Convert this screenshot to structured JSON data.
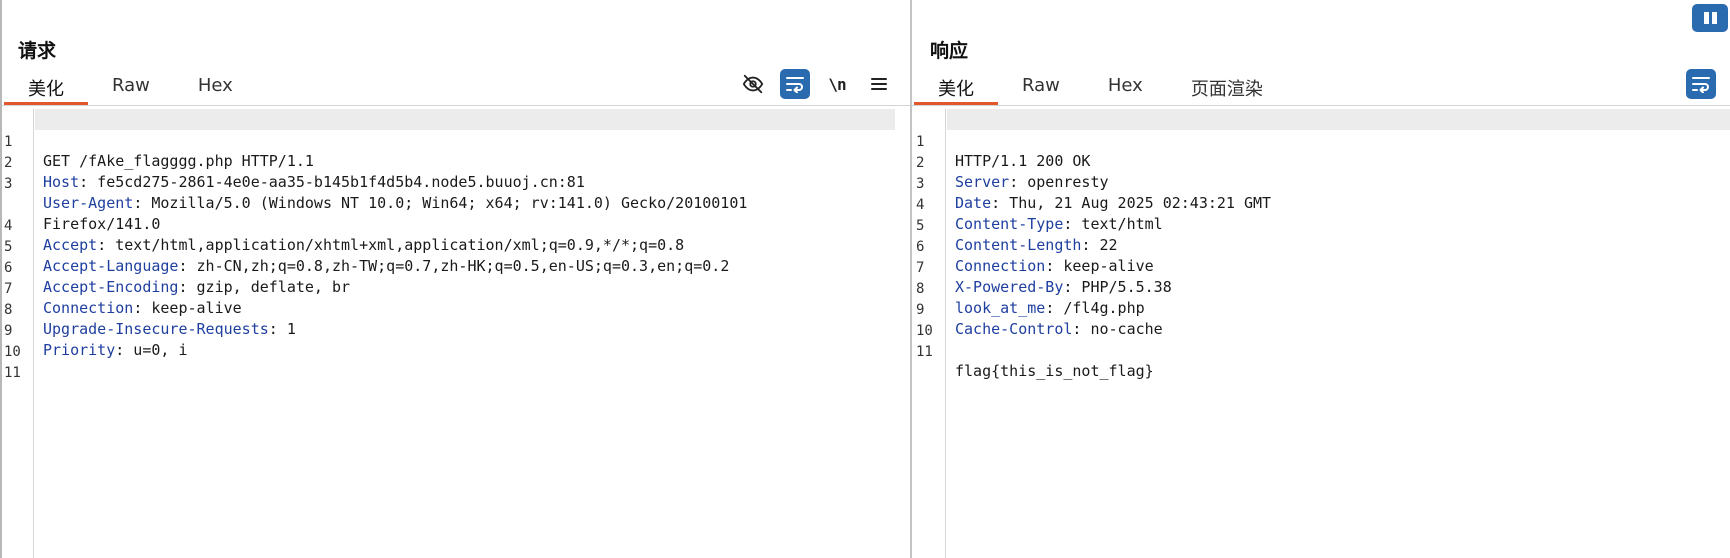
{
  "request": {
    "title": "请求",
    "tabs": [
      "美化",
      "Raw",
      "Hex"
    ],
    "toolbar": {
      "hide_icon": "eye-slash-icon",
      "wrap_icon": "wrap-lines-icon",
      "newline_label": "\\n",
      "menu_icon": "hamburger-menu-icon"
    },
    "lines": [
      {
        "n": "1",
        "first": "GET /fAke_flagggg.php HTTP/1.1",
        "key": "",
        "val": ""
      },
      {
        "n": "2",
        "first": "",
        "key": "Host",
        "val": ": fe5cd275-2861-4e0e-aa35-b145b1f4d5b4.node5.buuoj.cn:81"
      },
      {
        "n": "3",
        "first": "",
        "key": "User-Agent",
        "val": ": Mozilla/5.0 (Windows NT 10.0; Win64; x64; rv:141.0) Gecko/20100101",
        "cont": "Firefox/141.0"
      },
      {
        "n": "4",
        "first": "",
        "key": "Accept",
        "val": ": text/html,application/xhtml+xml,application/xml;q=0.9,*/*;q=0.8"
      },
      {
        "n": "5",
        "first": "",
        "key": "Accept-Language",
        "val": ": zh-CN,zh;q=0.8,zh-TW;q=0.7,zh-HK;q=0.5,en-US;q=0.3,en;q=0.2"
      },
      {
        "n": "6",
        "first": "",
        "key": "Accept-Encoding",
        "val": ": gzip, deflate, br"
      },
      {
        "n": "7",
        "first": "",
        "key": "Connection",
        "val": ": keep-alive"
      },
      {
        "n": "8",
        "first": "",
        "key": "Upgrade-Insecure-Requests",
        "val": ": 1"
      },
      {
        "n": "9",
        "first": "",
        "key": "Priority",
        "val": ": u=0, i"
      },
      {
        "n": "10",
        "first": "",
        "key": "",
        "val": ""
      },
      {
        "n": "11",
        "first": "",
        "key": "",
        "val": ""
      }
    ]
  },
  "response": {
    "title": "响应",
    "tabs": [
      "美化",
      "Raw",
      "Hex",
      "页面渲染"
    ],
    "toolbar": {
      "wrap_icon": "wrap-lines-icon"
    },
    "lines": [
      {
        "n": "1",
        "first": "HTTP/1.1 200 OK",
        "key": "",
        "val": ""
      },
      {
        "n": "2",
        "first": "",
        "key": "Server",
        "val": ": openresty"
      },
      {
        "n": "3",
        "first": "",
        "key": "Date",
        "val": ": Thu, 21 Aug 2025 02:43:21 GMT"
      },
      {
        "n": "4",
        "first": "",
        "key": "Content-Type",
        "val": ": text/html"
      },
      {
        "n": "5",
        "first": "",
        "key": "Content-Length",
        "val": ": 22"
      },
      {
        "n": "6",
        "first": "",
        "key": "Connection",
        "val": ": keep-alive"
      },
      {
        "n": "7",
        "first": "",
        "key": "X-Powered-By",
        "val": ": PHP/5.5.38"
      },
      {
        "n": "8",
        "first": "",
        "key": "look_at_me",
        "val": ": /fl4g.php"
      },
      {
        "n": "9",
        "first": "",
        "key": "Cache-Control",
        "val": ": no-cache"
      },
      {
        "n": "10",
        "first": "",
        "key": "",
        "val": ""
      },
      {
        "n": "11",
        "first": "flag{this_is_not_flag}",
        "key": "",
        "val": ""
      }
    ]
  },
  "corner": {
    "icon": "pause-icon"
  },
  "colors": {
    "accent_tab": "#e2572b",
    "button_blue": "#2a6bb0",
    "header_key": "#1f3fa0"
  }
}
